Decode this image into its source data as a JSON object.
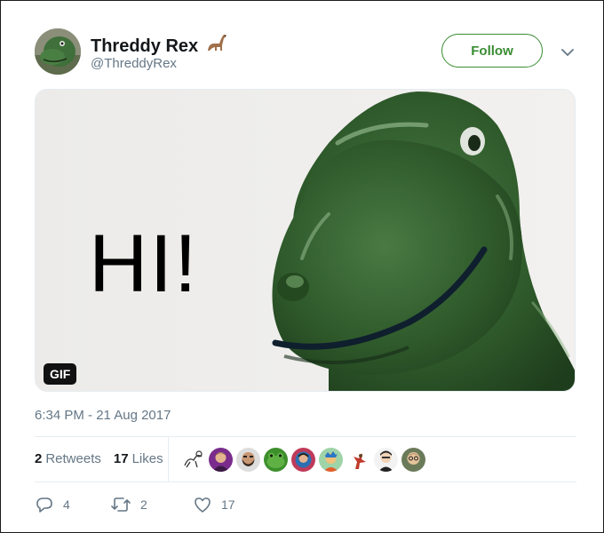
{
  "tweet": {
    "author": {
      "name": "Threddy Rex",
      "name_emoji": "sauropod-icon",
      "handle": "@ThreddyRex"
    },
    "follow_label": "Follow",
    "media": {
      "text": "HI!",
      "badge": "GIF"
    },
    "timestamp": "6:34 PM - 21 Aug 2017",
    "stats": {
      "retweets_count": "2",
      "retweets_label": "Retweets",
      "likes_count": "17",
      "likes_label": "Likes"
    },
    "actions": {
      "replies": "4",
      "retweets": "2",
      "likes": "17"
    }
  },
  "colors": {
    "accent": "#3a8d33",
    "secondary_text": "#657786",
    "primary_text": "#14171a",
    "divider": "#e6ecf0",
    "dino_green": "#2f5a2b"
  }
}
